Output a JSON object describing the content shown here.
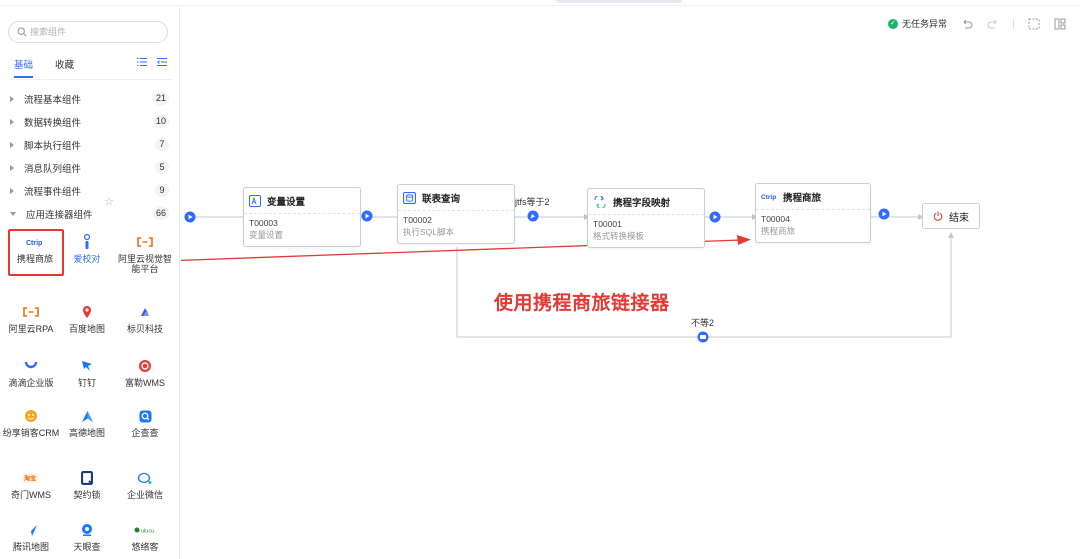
{
  "sidebar": {
    "search_placeholder": "搜索组件",
    "tabs": [
      {
        "label": "基础",
        "active": true
      },
      {
        "label": "收藏",
        "active": false
      }
    ],
    "groups": [
      {
        "label": "流程基本组件",
        "count": "21",
        "open": false
      },
      {
        "label": "数据转换组件",
        "count": "10",
        "open": false
      },
      {
        "label": "脚本执行组件",
        "count": "7",
        "open": false
      },
      {
        "label": "消息队列组件",
        "count": "5",
        "open": false
      },
      {
        "label": "流程事件组件",
        "count": "9",
        "open": false
      },
      {
        "label": "应用连接器组件",
        "count": "66",
        "open": true
      }
    ],
    "connectors": [
      {
        "label": "携程商旅",
        "icon": "ctrip-icon",
        "color": "#2f6bff"
      },
      {
        "label": "爱校对",
        "icon": "ixiaodui-icon",
        "color": "#2f6bff"
      },
      {
        "label": "阿里云视觉智能平台",
        "icon": "aliyun-icon",
        "color": "#ff6a00"
      },
      {
        "label": "阿里云RPA",
        "icon": "aliyun-icon",
        "color": "#ff6a00"
      },
      {
        "label": "百度地图",
        "icon": "baidu-map-icon",
        "color": "#e53935"
      },
      {
        "label": "标贝科技",
        "icon": "biaobei-icon",
        "color": "#3a5bd9"
      },
      {
        "label": "滴滴企业版",
        "icon": "didi-icon",
        "color": "#2f6bff"
      },
      {
        "label": "钉钉",
        "icon": "dingtalk-icon",
        "color": "#1677ff"
      },
      {
        "label": "富勒WMS",
        "icon": "fuller-icon",
        "color": "#e53935"
      },
      {
        "label": "纷享销客CRM",
        "icon": "fxiaoke-icon",
        "color": "#f5a623"
      },
      {
        "label": "高德地图",
        "icon": "amap-icon",
        "color": "#1677ff"
      },
      {
        "label": "企查查",
        "icon": "qichacha-icon",
        "color": "#1677ff"
      },
      {
        "label": "奇门WMS",
        "icon": "qimen-icon",
        "color": "#ff6a00"
      },
      {
        "label": "契约锁",
        "icon": "qiyuesuo-icon",
        "color": "#1e3a8a"
      },
      {
        "label": "企业微信",
        "icon": "wecom-icon",
        "color": "#1677ff"
      },
      {
        "label": "腾讯地图",
        "icon": "tencent-map-icon",
        "color": "#1677ff"
      },
      {
        "label": "天眼查",
        "icon": "tianyancha-icon",
        "color": "#1677ff"
      },
      {
        "label": "悠络客",
        "icon": "ulucu-icon",
        "color": "#2e7d32"
      }
    ]
  },
  "toolbar": {
    "status": "无任务异常"
  },
  "flow": {
    "nodes": [
      {
        "title": "变量设置",
        "code": "T00003",
        "desc": "变量设置",
        "icon": "variable-icon"
      },
      {
        "title": "联表查询",
        "code": "T00002",
        "desc": "执行SQL脚本",
        "icon": "database-icon"
      },
      {
        "title": "携程字段映射",
        "code": "T00001",
        "desc": "格式转换模板",
        "icon": "mapping-icon"
      },
      {
        "title": "携程商旅",
        "code": "T00004",
        "desc": "携程商旅",
        "icon": "ctrip-icon"
      }
    ],
    "end_label": "结束",
    "condition_true": "jtfs等于2",
    "condition_false": "不等2"
  },
  "annotation": "使用携程商旅链接器"
}
